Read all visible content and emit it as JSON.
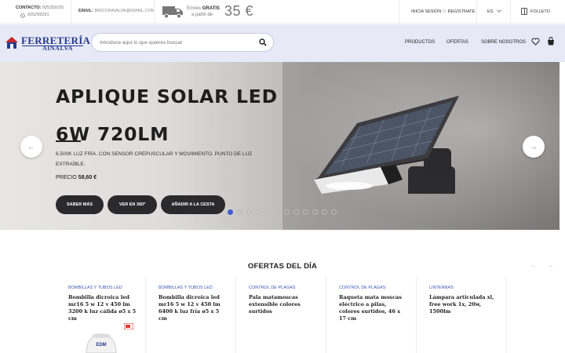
{
  "topbar": {
    "contact_label": "CONTACTO:",
    "phone1": "925259291",
    "phone2": "925259291",
    "email_label": "EMAIL:",
    "email": "BRICOAINALVA@GMAIL.COM",
    "shipping_line1_prefix": "Envios",
    "shipping_line1_bold": "GRATIS",
    "shipping_line2": "a partir de",
    "shipping_amount": "35 €",
    "login": "INICIA SESION",
    "or": "O",
    "register": "REGISTRATE",
    "lang": "ES",
    "folleto": "FOLLETO"
  },
  "header": {
    "logo_line1": "FERRETERÍA",
    "logo_line2": "AINALVA",
    "search_placeholder": "Introduce aquí lo que quieres buscar",
    "nav": [
      "PRODUCTOS",
      "OFERTAS",
      "SOBRE NOSOTROS"
    ]
  },
  "hero": {
    "title": "APLIQUE SOLAR LED 6W 720LM",
    "description": "6.500K LUZ FRÍA. CON SENSOR CREPUSCULAR Y MOVIMIENTO. PUNTO DE LUZ EXTRAÍBLE.",
    "price_label": "PRECIO",
    "price_value": "58,60 €",
    "buttons": [
      "SABER MÁS",
      "VER EN 360º",
      "AÑADIR A LA CESTA"
    ],
    "prev_arrow": "←",
    "next_arrow": "→",
    "slide_count": 12,
    "active_slide": 1
  },
  "offers": {
    "title": "OFERTAS DEL DÍA",
    "prev": "←",
    "next": "→",
    "cards": [
      {
        "category": "BOMBILLAS Y TUBOS LED",
        "name": "Bombilla dicroica led mr16 5 w 12 v 450 lm 3200 k luz cálida ø5 x 5 cm"
      },
      {
        "category": "BOMBILLAS Y TUBOS LED",
        "name": "Bombilla dicroica led mr16 5 w 12 v 450 lm 6400 k luz fría ø5 x 5 cm"
      },
      {
        "category": "CONTROL DE PLAGAS",
        "name": "Pala matamoscas extensible colores surtidos"
      },
      {
        "category": "CONTROL DE PLAGAS",
        "name": "Raqueta mata moscas eléctrico a pilas, colores surtidos, 46 x 17 cm"
      },
      {
        "category": "LINTERNAS",
        "name": "Lámpara articulada xl, free work 1x, 20w, 1500lm"
      }
    ],
    "product_brand": "EDM"
  },
  "colors": {
    "brand": "#253a8c",
    "nav_bg": "#e7e9f6",
    "button_dark": "#2a2a2c",
    "dot_active": "#3d5bd6",
    "category": "#3a59b8"
  }
}
